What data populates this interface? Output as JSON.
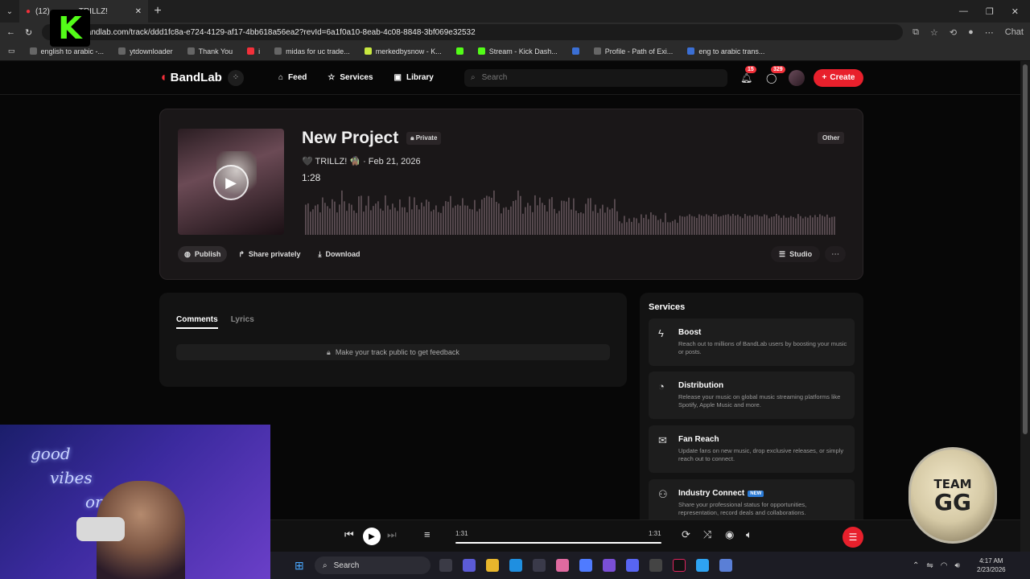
{
  "browser": {
    "tab_title": "(12)",
    "tab_extra": "TRILLZ!",
    "url": "bandlab.com/track/ddd1fc8a-e724-4129-af17-4bb618a56ea2?revId=6a1f0a10-8eab-4c08-8848-3bf069e32532",
    "chat_label": "Chat",
    "bookmarks": [
      "english to arabic -...",
      "ytdownloader",
      "Thank You",
      "i",
      "midas for uc trade...",
      "merkedbysnow - K...",
      "Stream - Kick Dash...",
      "",
      "Profile - Path of Exi...",
      "eng to arabic trans..."
    ]
  },
  "nav": {
    "brand": "BandLab",
    "feed": "Feed",
    "services": "Services",
    "library": "Library",
    "search_placeholder": "Search",
    "notifications_count": "15",
    "messages_count": "329",
    "create": "Create"
  },
  "track": {
    "title": "New Project",
    "visibility": "Private",
    "artist_date": "🖤 TRILLZ! 🧌 · Feb 21, 2026",
    "duration": "1:28",
    "genre": "Other",
    "actions": {
      "publish": "Publish",
      "share": "Share privately",
      "download": "Download",
      "studio": "Studio"
    }
  },
  "comments": {
    "tab_comments": "Comments",
    "tab_lyrics": "Lyrics",
    "feedback": "Make your track public to get feedback"
  },
  "services": {
    "title": "Services",
    "items": [
      {
        "name": "Boost",
        "desc": "Reach out to millions of BandLab users by boosting your music or posts."
      },
      {
        "name": "Distribution",
        "desc": "Release your music on global music streaming platforms like Spotify, Apple Music and more."
      },
      {
        "name": "Fan Reach",
        "desc": "Update fans on new music, drop exclusive releases, or simply reach out to connect."
      },
      {
        "name": "Industry Connect",
        "badge": "NEW",
        "desc": "Share your professional status for opportunities, representation, record deals and collaborations."
      }
    ]
  },
  "player": {
    "elapsed": "1:31",
    "total": "1:31",
    "progress": 1.0
  },
  "taskbar": {
    "search": "Search",
    "time": "4:17 AM",
    "date": "2/23/2026"
  },
  "overlay": {
    "webcam_text": [
      "good",
      "vibes",
      "on"
    ],
    "coin_top": "TEAM",
    "coin_bottom": "GG"
  },
  "colors": {
    "accent": "#e8202c",
    "kick_green": "#53fc18"
  }
}
